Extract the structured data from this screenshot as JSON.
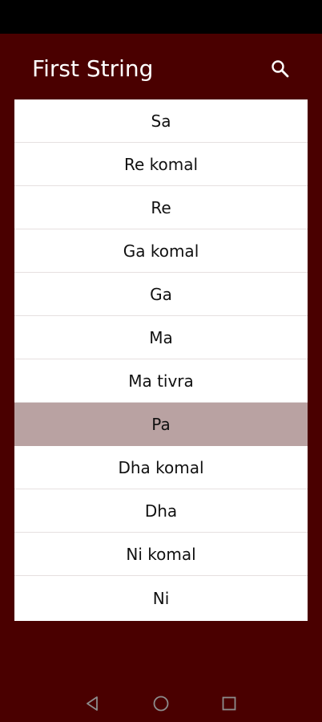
{
  "app_bar": {
    "title": "First String",
    "search_icon": "search-icon"
  },
  "list": {
    "items": [
      {
        "label": "Sa",
        "selected": false
      },
      {
        "label": "Re komal",
        "selected": false
      },
      {
        "label": "Re",
        "selected": false
      },
      {
        "label": "Ga komal",
        "selected": false
      },
      {
        "label": "Ga",
        "selected": false
      },
      {
        "label": "Ma",
        "selected": false
      },
      {
        "label": "Ma tivra",
        "selected": false
      },
      {
        "label": "Pa",
        "selected": true
      },
      {
        "label": "Dha komal",
        "selected": false
      },
      {
        "label": "Dha",
        "selected": false
      },
      {
        "label": "Ni komal",
        "selected": false
      },
      {
        "label": "Ni",
        "selected": false
      }
    ]
  },
  "nav_bar": {
    "back_icon": "back-triangle-icon",
    "home_icon": "home-circle-icon",
    "recents_icon": "recents-square-icon"
  },
  "colors": {
    "background": "#4a0000",
    "status_bar": "#000000",
    "selected_row": "#b9a2a2",
    "list_background": "#ffffff"
  }
}
